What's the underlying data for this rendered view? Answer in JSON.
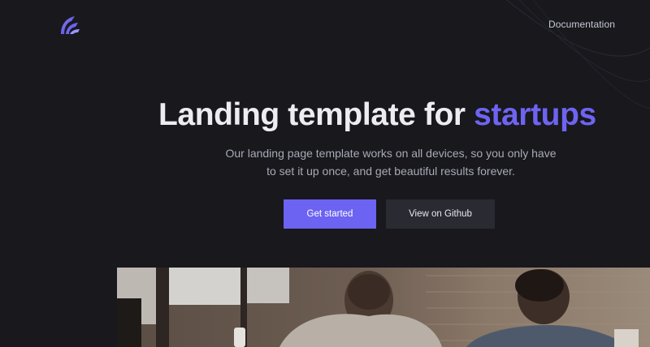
{
  "header": {
    "logo_icon": "brand-logo-icon",
    "nav": {
      "documentation_label": "Documentation"
    }
  },
  "hero": {
    "title_main": "Landing template for ",
    "title_accent": "startups",
    "subtitle_line1": "Our landing page template works on all devices, so you only have",
    "subtitle_line2": "to set it up once, and get beautiful results forever.",
    "primary_button": "Get started",
    "secondary_button": "View on Github"
  },
  "media": {
    "description_icon": "hero-photo-people-working"
  },
  "colors": {
    "background": "#18181d",
    "accent": "#6c63f2",
    "title": "#ececf1",
    "subtitle": "#a8aab6",
    "secondary_button": "#2a2b32"
  }
}
